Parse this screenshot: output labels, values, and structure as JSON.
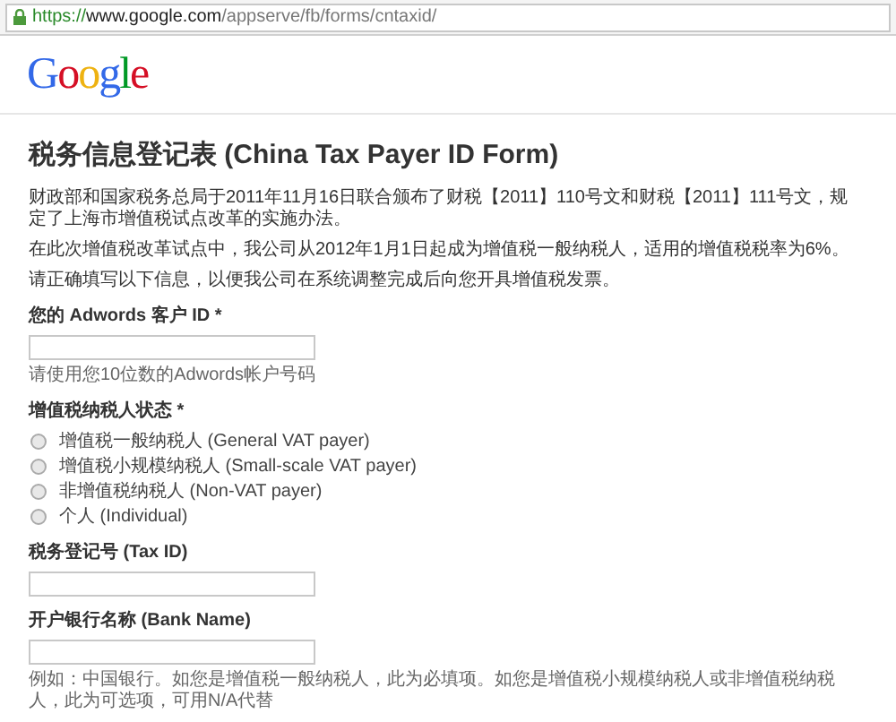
{
  "address_bar": {
    "scheme": "https://",
    "host": "www.google.com",
    "path": "/appserve/fb/forms/cntaxid/"
  },
  "logo": "Google",
  "title": "税务信息登记表 (China Tax Payer ID Form)",
  "paragraphs": [
    "财政部和国家税务总局于2011年11月16日联合颁布了财税【2011】110号文和财税【2011】111号文，规定了上海市增值税试点改革的实施办法。",
    "在此次增值税改革试点中，我公司从2012年1月1日起成为增值税一般纳税人，适用的增值税税率为6%。",
    "请正确填写以下信息，以便我公司在系统调整完成后向您开具增值税发票。"
  ],
  "fields": [
    {
      "kind": "text",
      "label": "您的 Adwords 客户 ID *",
      "hint": "请使用您10位数的Adwords帐户号码"
    },
    {
      "kind": "radio",
      "label": "增值税纳税人状态 *",
      "options": [
        {
          "label": "增值税一般纳税人 (General VAT payer)",
          "selected": false
        },
        {
          "label": "增值税小规模纳税人 (Small-scale VAT payer)",
          "selected": false
        },
        {
          "label": "非增值税纳税人 (Non-VAT payer)",
          "selected": false
        },
        {
          "label": "个人 (Individual)",
          "selected": false
        }
      ]
    },
    {
      "kind": "text",
      "label": "税务登记号 (Tax ID)"
    },
    {
      "kind": "text",
      "label": "开户银行名称 (Bank Name)",
      "hint": "例如：中国银行。如您是增值税一般纳税人，此为必填项。如您是增值税小规模纳税人或非增值税纳税人，此为可选项，可用N/A代替"
    }
  ]
}
